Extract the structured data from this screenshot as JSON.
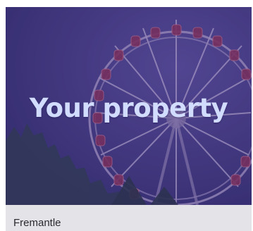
{
  "card": {
    "title": "Your property",
    "location": "Fremantle",
    "image_subject": "ferris-wheel-at-dusk",
    "colors": {
      "title_text": "#d2dcff",
      "overlay": "#3e3282",
      "footer_bg": "#e4e4e8",
      "footer_text": "#2a2a2e"
    }
  }
}
